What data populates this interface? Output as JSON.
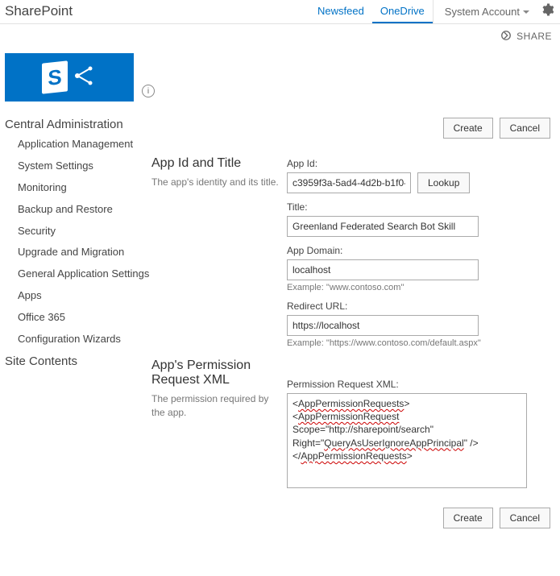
{
  "suite": {
    "brand": "SharePoint",
    "links": [
      {
        "label": "Newsfeed",
        "active": false
      },
      {
        "label": "OneDrive",
        "active": true
      }
    ],
    "user": "System Account",
    "share": "SHARE"
  },
  "nav": {
    "header": "Central Administration",
    "items": [
      "Application Management",
      "System Settings",
      "Monitoring",
      "Backup and Restore",
      "Security",
      "Upgrade and Migration",
      "General Application Settings",
      "Apps",
      "Office 365",
      "Configuration Wizards"
    ],
    "footer": "Site Contents"
  },
  "sections": {
    "ident": {
      "title": "App Id and Title",
      "desc": "The app's identity and its title."
    },
    "perm": {
      "title": "App's Permission Request XML",
      "desc": "The permission required by the app."
    }
  },
  "buttons": {
    "create": "Create",
    "cancel": "Cancel",
    "lookup": "Lookup"
  },
  "form": {
    "appid_label": "App Id:",
    "appid_value": "c3959f3a-5ad4-4d2b-b1f0-b",
    "title_label": "Title:",
    "title_value": "Greenland Federated Search Bot Skill",
    "domain_label": "App Domain:",
    "domain_value": "localhost",
    "domain_example": "Example: \"www.contoso.com\"",
    "redirect_label": "Redirect URL:",
    "redirect_value": "https://localhost",
    "redirect_example": "Example: \"https://www.contoso.com/default.aspx\"",
    "xml_label": "Permission Request XML:",
    "xml": {
      "line1": "AppPermissionRequests",
      "line2": "AppPermissionRequest",
      "line3a": "Scope=\"http://sharepoint/search\"",
      "line3b": "QueryAsUserIgnoreAppPrincipal",
      "line4": "AppPermissionRequests"
    }
  }
}
